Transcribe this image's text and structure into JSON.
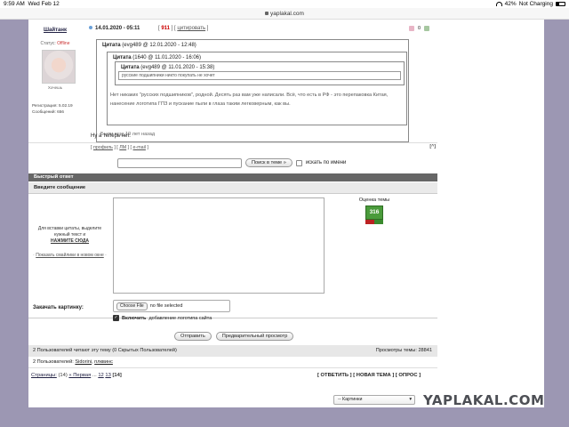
{
  "status": {
    "time": "9:59 AM",
    "date": "Wed Feb 12",
    "battery": "42%",
    "charging": "Not Charging"
  },
  "browser": {
    "url": "yaplakal.com"
  },
  "post": {
    "author": "Шайтанк",
    "status_label": "Статус:",
    "status_value": "Offline",
    "avatar_caption": "Хочешь",
    "registered": "Регистрация: 5.02.19",
    "messages": "Сообщений: 656",
    "date": "14.01.2020 - 05:11",
    "rating_num": "911",
    "quote_action": "цитировать",
    "icon_count": "0",
    "quote_title": "Цитата",
    "quote_meta": "(evg489 @ 12.01.2020 - 12:48)",
    "quote2_title": "Цитата",
    "quote2_meta": "(1640 @ 11.01.2020 - 16:06)",
    "quote3_title": "Цитата",
    "quote3_meta": "(evg489 @ 11.01.2020 - 15:38)",
    "quote3_text": "русские подшипники никто покупать не хочет",
    "quote2_text": "Нет никаких \"русских подшипников\", родной. Десять раз вам уже написали. Всё, что есть в РФ - это перепаковка Китая, нанесение логотипа ГПЗ и пускание пыли в глаза таким легковерным, как вы.",
    "quote2_foot": "Были еще 10 лет назад",
    "body": "Ну а теперь нет.",
    "footer_profile": "профиль",
    "footer_pm": "ЛМ",
    "footer_email": "e-mail",
    "footer_top": "[^]"
  },
  "search": {
    "button": "Поиск в теме »",
    "by_name": "искать по имени"
  },
  "quick_reply": {
    "title": "Быстрый ответ",
    "subtitle": "Введите сообщение",
    "hint": "Для вставки цитаты, выделите нужный текст и",
    "hint_bold": "НАЖМИТЕ СЮДА",
    "smileys_pre": "·",
    "smileys": "Показать смайлики в новом окне",
    "smileys_post": "·",
    "rating_title": "Оценка темы",
    "rating_value": "316",
    "attach_label": "Закачать картинку:",
    "file_button": "Choose File",
    "file_status": "no file selected",
    "logo_bold": "Включить",
    "logo_rest": "добавление логотипа сайта",
    "send": "Отправить",
    "preview": "Предварительный просмотр"
  },
  "viewers": {
    "reading": "2 Пользователей читают эту тему (0 Скрытых Пользователей)",
    "views": "Просмотры темы: 28841",
    "users_prefix": "2 Пользователей:",
    "user1": "Sidorini",
    "user2": "плквинс"
  },
  "pager": {
    "label": "Страницы:",
    "count": "(14)",
    "first": "« Первая",
    "dots": "...",
    "p12": "12",
    "p13": "13",
    "p14": "[14]"
  },
  "topic_actions": "[ ОТВЕТИТЬ ] [ НОВАЯ ТЕМА ] [ ОПРОС ]",
  "bottom_select": "-- Картинки",
  "watermark": "YAPLAKAL.COM"
}
